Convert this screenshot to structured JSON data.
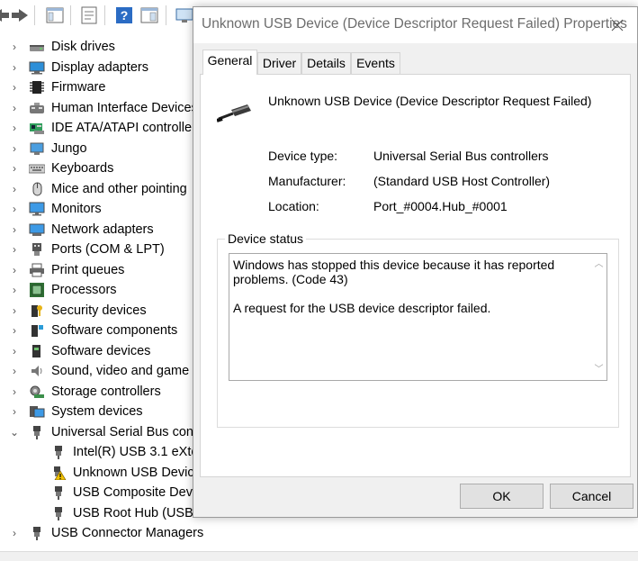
{
  "device_tree": {
    "items": [
      {
        "label": "Disk drives",
        "expanded": false,
        "icon": "disk-drive-icon"
      },
      {
        "label": "Display adapters",
        "expanded": false,
        "icon": "display-adapter-icon"
      },
      {
        "label": "Firmware",
        "expanded": false,
        "icon": "firmware-icon"
      },
      {
        "label": "Human Interface Devices",
        "expanded": false,
        "icon": "hid-icon"
      },
      {
        "label": "IDE ATA/ATAPI controllers",
        "expanded": false,
        "icon": "ide-controller-icon"
      },
      {
        "label": "Jungo",
        "expanded": false,
        "icon": "jungo-icon"
      },
      {
        "label": "Keyboards",
        "expanded": false,
        "icon": "keyboard-icon"
      },
      {
        "label": "Mice and other pointing",
        "expanded": false,
        "icon": "mouse-icon"
      },
      {
        "label": "Monitors",
        "expanded": false,
        "icon": "monitor-icon"
      },
      {
        "label": "Network adapters",
        "expanded": false,
        "icon": "network-adapter-icon"
      },
      {
        "label": "Ports (COM & LPT)",
        "expanded": false,
        "icon": "port-icon"
      },
      {
        "label": "Print queues",
        "expanded": false,
        "icon": "printer-icon"
      },
      {
        "label": "Processors",
        "expanded": false,
        "icon": "processor-icon"
      },
      {
        "label": "Security devices",
        "expanded": false,
        "icon": "security-device-icon"
      },
      {
        "label": "Software components",
        "expanded": false,
        "icon": "software-component-icon"
      },
      {
        "label": "Software devices",
        "expanded": false,
        "icon": "software-device-icon"
      },
      {
        "label": "Sound, video and game",
        "expanded": false,
        "icon": "sound-icon"
      },
      {
        "label": "Storage controllers",
        "expanded": false,
        "icon": "storage-controller-icon"
      },
      {
        "label": "System devices",
        "expanded": false,
        "icon": "system-device-icon"
      },
      {
        "label": "Universal Serial Bus cont",
        "expanded": true,
        "icon": "usb-plug-icon"
      },
      {
        "label": "Intel(R) USB 3.1 eXter",
        "child": true,
        "icon": "usb-plug-icon"
      },
      {
        "label": "Unknown USB Devic",
        "child": true,
        "icon": "usb-warning-icon",
        "warning": true
      },
      {
        "label": "USB Composite Devi",
        "child": true,
        "icon": "usb-plug-icon"
      },
      {
        "label": "USB Root Hub (USB 3.",
        "child": true,
        "icon": "usb-plug-icon"
      },
      {
        "label": "USB Connector Managers",
        "expanded": false,
        "icon": "usb-plug-icon"
      }
    ]
  },
  "dialog": {
    "title": "Unknown USB Device (Device Descriptor Request Failed) Properties",
    "close_icon": "close-icon",
    "tabs": [
      "General",
      "Driver",
      "Details",
      "Events"
    ],
    "active_tab": "General",
    "device_name": "Unknown USB Device (Device Descriptor Request Failed)",
    "properties": [
      {
        "label": "Device type:",
        "value": "Universal Serial Bus controllers"
      },
      {
        "label": "Manufacturer:",
        "value": "(Standard USB Host Controller)"
      },
      {
        "label": "Location:",
        "value": "Port_#0004.Hub_#0001"
      }
    ],
    "status": {
      "legend": "Device status",
      "line1": "Windows has stopped this device because it has reported problems. (Code 43)",
      "line2": "A request for the USB device descriptor failed."
    },
    "ok_label": "OK",
    "cancel_label": "Cancel"
  },
  "colors": {
    "warning": "#f2c200",
    "accent_blue": "#2b6cc4"
  }
}
